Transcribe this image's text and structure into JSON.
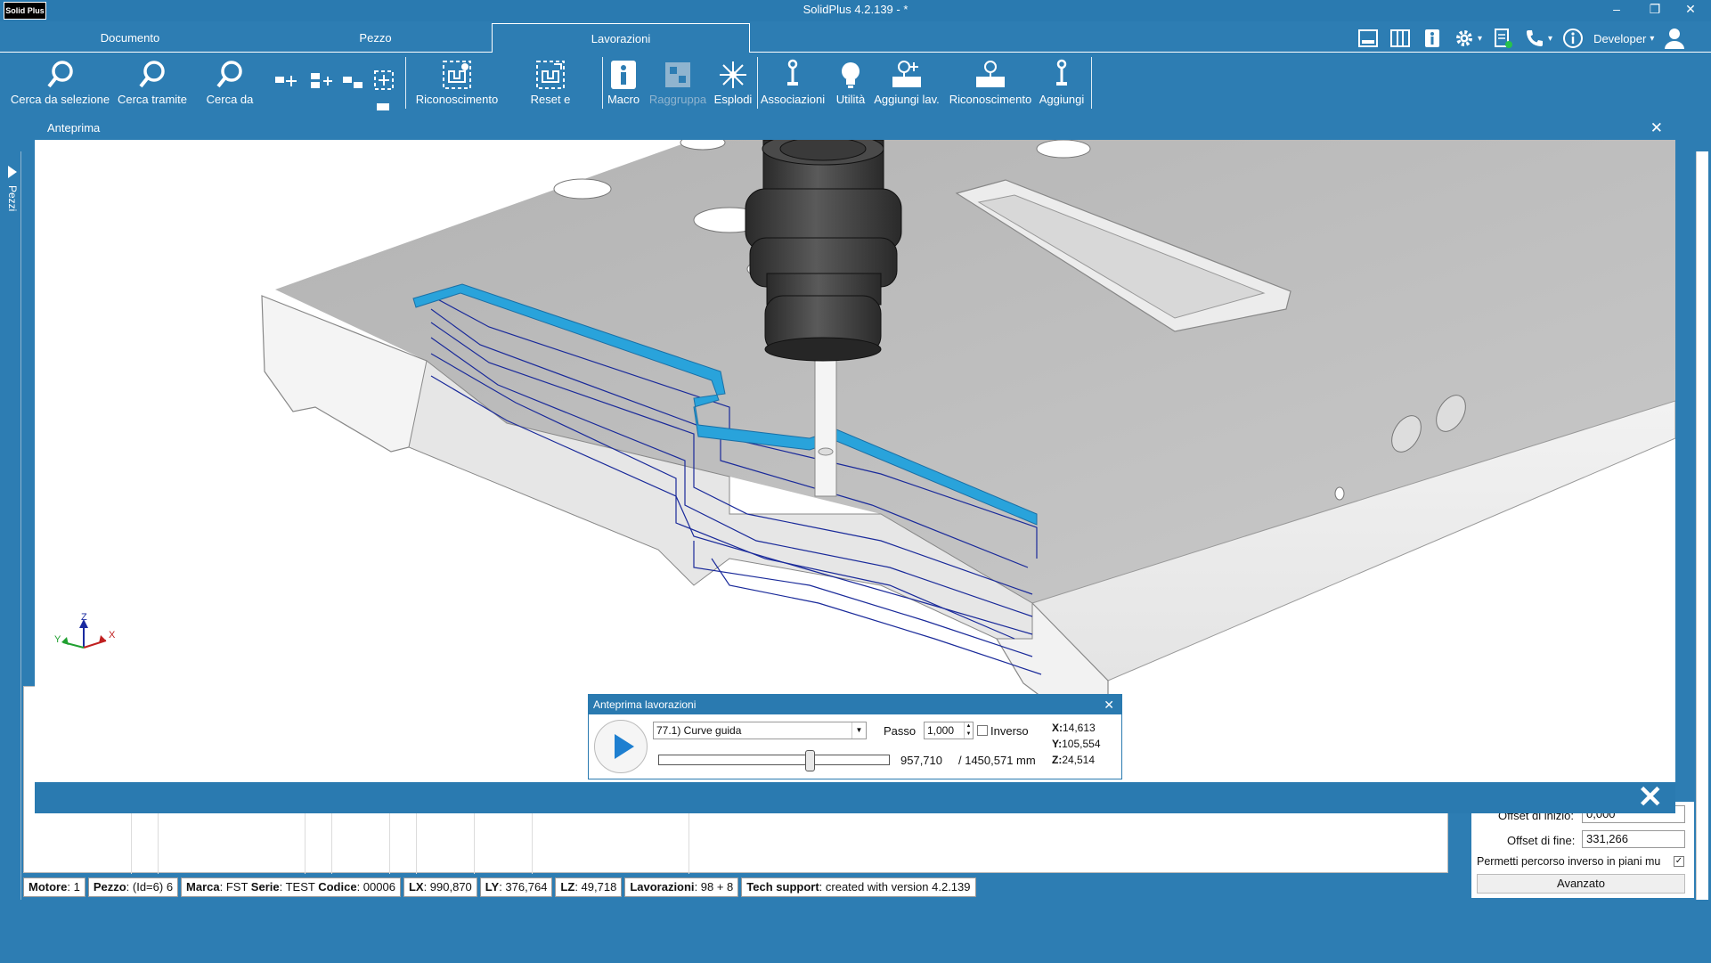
{
  "app": {
    "logo": "Solid Plus",
    "title": "SolidPlus  4.2.139 - *",
    "window_buttons": [
      "–",
      "❐",
      "✕"
    ]
  },
  "tabs": [
    {
      "label": "Documento"
    },
    {
      "label": "Pezzo"
    },
    {
      "label": "Lavorazioni"
    }
  ],
  "header_right": {
    "user": "Developer",
    "dropdown_glyph": "▾"
  },
  "ribbon": {
    "cerca_selezione": "Cerca da selezione",
    "cerca_tramite": "Cerca tramite",
    "cerca_da": "Cerca da",
    "riconoscimento": "Riconoscimento",
    "reset": "Reset e",
    "macro": "Macro",
    "raggruppa": "Raggruppa",
    "esplodi": "Esplodi",
    "associazioni": "Associazioni",
    "utilita": "Utilità",
    "aggiungi_lav": "Aggiungi lav.",
    "riconoscimento2": "Riconoscimento",
    "aggiungi": "Aggiungi"
  },
  "side_tab": {
    "label": "Pezzi"
  },
  "preview_window": {
    "title": "Anteprima",
    "close_glyph": "✕",
    "footer_close_glyph": "✕"
  },
  "axes": {
    "x": "X",
    "y": "Y",
    "z": "Z"
  },
  "machining_dialog": {
    "title": "Anteprima lavorazioni",
    "close_glyph": "✕",
    "selected_operation": "77.1) Curve guida",
    "passo_label": "Passo",
    "passo_value": "1,000",
    "inverso_label": "Inverso",
    "inverso_checked": false,
    "position_value": "957,710",
    "total_value": "/ 1450,571 mm",
    "progress_fraction": 0.66,
    "x_label": "X:",
    "x_value": "14,613",
    "y_label": "Y:",
    "y_value": "105,554",
    "z_label": "Z:",
    "z_value": "24,514"
  },
  "right_panel": {
    "offset_inizio_label": "Offset di inizio:",
    "offset_inizio_value": "0,000",
    "offset_fine_label": "Offset di fine:",
    "offset_fine_value": "331,266",
    "permetti_label": "Permetti percorso inverso in piani mu",
    "permetti_checked": true,
    "avanzato_label": "Avanzato"
  },
  "status_bar": {
    "motore_label": "Motore",
    "motore_value": ": 1",
    "pezzo_label": "Pezzo",
    "pezzo_value": ": (Id=6) 6",
    "marca_label": "Marca",
    "marca_value": ": FST",
    "serie_label": "Serie",
    "serie_value": ": TEST",
    "codice_label": "Codice",
    "codice_value": ": 00006",
    "lx_label": "LX",
    "lx_value": ": 990,870",
    "ly_label": "LY",
    "ly_value": ": 376,764",
    "lz_label": "LZ",
    "lz_value": ": 49,718",
    "lavorazioni_label": "Lavorazioni",
    "lavorazioni_value": ": 98 + 8",
    "tech_label": "Tech support",
    "tech_value": ": created with version 4.2.139"
  },
  "colors": {
    "accent": "#2d7db3",
    "toolpath_highlight": "#29a3db",
    "toolpath_lines": "#1a2a9a",
    "spindle": "#3a3a3a"
  }
}
